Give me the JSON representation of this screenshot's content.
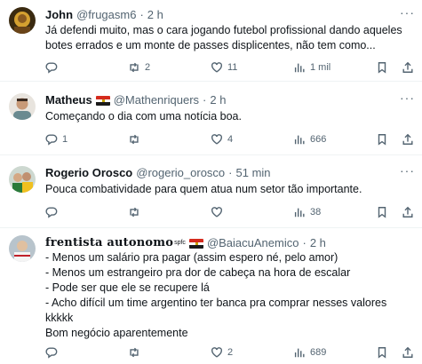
{
  "tweets": [
    {
      "name": "John",
      "handle": "@frugasm6",
      "time": "2 h",
      "lines": [
        "Já defendi muito, mas o cara jogando futebol profissional dando aqueles",
        "botes errados e um monte de passes displicentes, não tem como..."
      ],
      "reply_count": "",
      "retweet_count": "2",
      "like_count": "11",
      "view_count": "1 mil",
      "more": "···"
    },
    {
      "name": "Matheus",
      "handle": "@Mathenriquers",
      "time": "2 h",
      "lines": [
        "Começando o dia com uma notícia boa."
      ],
      "reply_count": "1",
      "retweet_count": "",
      "like_count": "4",
      "view_count": "666",
      "more": "···"
    },
    {
      "name": "Rogerio Orosco",
      "handle": "@rogerio_orosco",
      "time": "51 min",
      "lines": [
        "Pouca combatividade para quem atua num setor tão importante."
      ],
      "reply_count": "",
      "retweet_count": "",
      "like_count": "",
      "view_count": "38",
      "more": "···"
    },
    {
      "name": "𝐟𝐫𝐞𝐧𝐭𝐢𝐬𝐭𝐚 𝐚𝐮𝐭𝐨𝐧𝐨𝐦𝐨",
      "name_sup": "spfc",
      "handle": "@BaiacuAnemico",
      "time": "2 h",
      "lines": [
        "- Menos um salário pra pagar (assim espero né, pelo amor)",
        "- Menos um estrangeiro pra dor de cabeça na hora de escalar",
        "- Pode ser que ele se recupere lá",
        "- Acho difícil um time argentino ter banca pra comprar nesses valores",
        "kkkkk",
        "Bom negócio aparentemente"
      ],
      "reply_count": "",
      "retweet_count": "",
      "like_count": "2",
      "view_count": "689",
      "more": ""
    }
  ],
  "colors": {
    "text": "#0f1419",
    "secondary": "#536471",
    "divider": "#eff3f4"
  }
}
